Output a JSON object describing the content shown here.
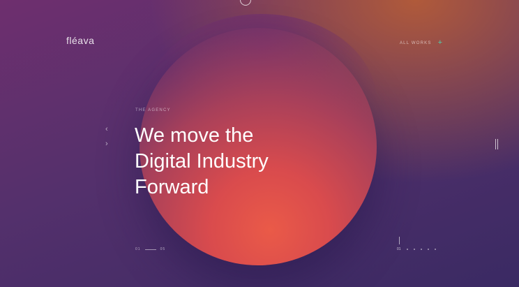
{
  "brand": {
    "logo": "fléava"
  },
  "nav": {
    "all_works_label": "ALL WORKS",
    "plus_icon": "plus-icon",
    "accent": "#4fd1b0"
  },
  "hero": {
    "section_label": "THE AGENCY",
    "headline": [
      "We move the",
      "Digital Industry",
      "Forward"
    ]
  },
  "pager": {
    "current": "01",
    "total": "05"
  },
  "indicators": {
    "active_label": "01",
    "count": 5
  }
}
